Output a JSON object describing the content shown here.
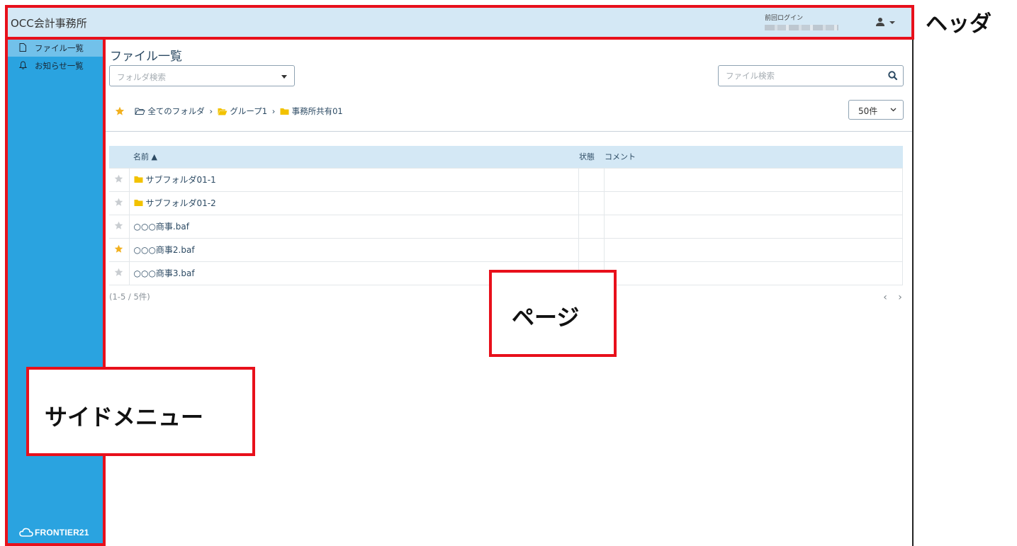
{
  "header": {
    "title": "OCC会計事務所",
    "last_login_label": "前回ログイン",
    "user_icon": "user-icon"
  },
  "sidebar": {
    "items": [
      {
        "label": "ファイル一覧",
        "icon": "file-icon",
        "active": true
      },
      {
        "label": "お知らせ一覧",
        "icon": "bell-icon",
        "active": false
      }
    ],
    "logo": "FRONTIER21"
  },
  "page": {
    "title": "ファイル一覧",
    "folder_search_placeholder": "フォルダ検索",
    "file_search_placeholder": "ファイル検索",
    "breadcrumb": [
      "全てのフォルダ",
      "グループ1",
      "事務所共有01"
    ],
    "per_page": "50件",
    "table": {
      "headers": {
        "name": "名前 ▲",
        "state": "状態",
        "comment": "コメント"
      },
      "rows": [
        {
          "name": "サブフォルダ01-1",
          "type": "folder",
          "starred": false
        },
        {
          "name": "サブフォルダ01-2",
          "type": "folder",
          "starred": false
        },
        {
          "name": "○○○商事.baf",
          "type": "file",
          "starred": false
        },
        {
          "name": "○○○商事2.baf",
          "type": "file",
          "starred": true
        },
        {
          "name": "○○○商事3.baf",
          "type": "file",
          "starred": false
        }
      ]
    },
    "count_text": "(1-5 / 5件)",
    "pager": {
      "prev": "‹",
      "next": "›"
    }
  },
  "annotations": {
    "header": "ヘッダ",
    "page": "ページ",
    "sidemenu": "サイドメニュー"
  },
  "colors": {
    "header_bg": "#d4e8f5",
    "sidebar_bg": "#2aa3e0",
    "sidebar_active": "#72c1ea",
    "star_active": "#f2b01e",
    "folder": "#f2c200",
    "annotation_red": "#e8101b"
  }
}
